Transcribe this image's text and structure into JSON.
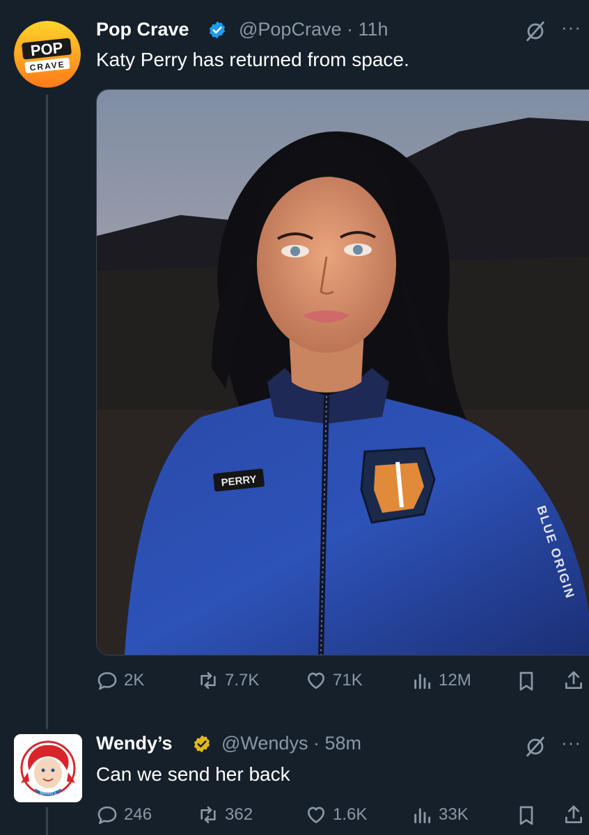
{
  "tweet1": {
    "avatar_text_top": "POP",
    "avatar_text_bottom": "CRAVE",
    "name": "Pop Crave",
    "handle_time": "@PopCrave · 11h",
    "text": "Katy Perry has returned from space.",
    "media_patch_text": "PERRY",
    "media_sleeve_text": "BLUE ORIGIN",
    "stats": {
      "replies": "2K",
      "reposts": "7.7K",
      "likes": "71K",
      "views": "12M"
    }
  },
  "tweet2": {
    "avatar_text": "Wendy's",
    "name": "Wendy’s",
    "handle_time": "@Wendys · 58m",
    "text": "Can we send her back",
    "stats": {
      "replies": "246",
      "reposts": "362",
      "likes": "1.6K",
      "views": "33K"
    }
  },
  "colors": {
    "background": "#15202b",
    "muted": "#8b98a5",
    "verified_blue": "#1d9bf0",
    "verified_gold": "#e2b719"
  },
  "icons": [
    "grok-icon",
    "more-icon",
    "reply-icon",
    "repost-icon",
    "like-icon",
    "views-icon",
    "bookmark-icon",
    "share-icon",
    "verified-badge-icon"
  ]
}
